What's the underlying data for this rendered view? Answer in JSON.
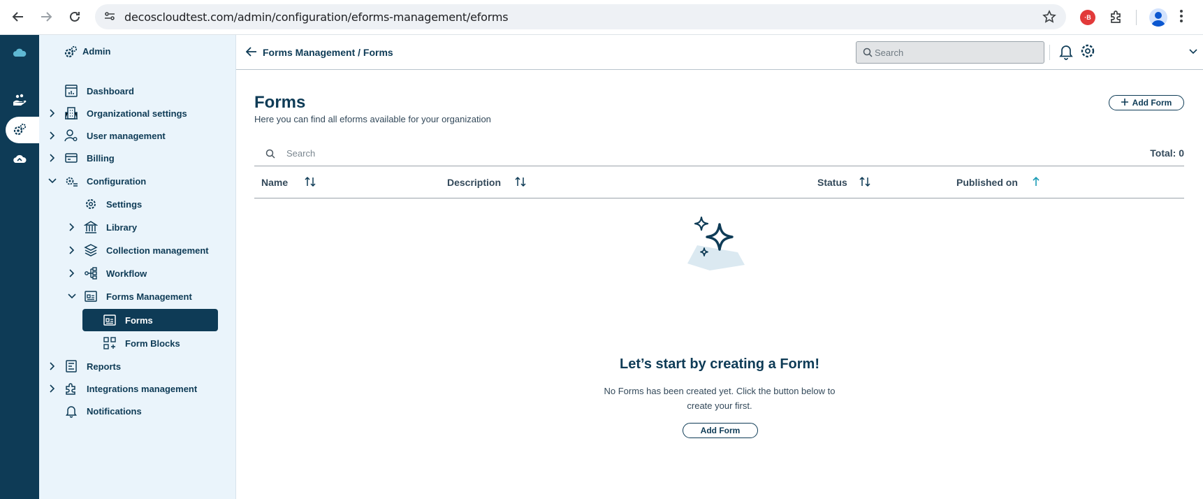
{
  "browser": {
    "url": "decoscloudtest.com/admin/configuration/eforms-management/eforms",
    "extension_badge": "·B"
  },
  "sidebar": {
    "title": "Admin",
    "items": [
      {
        "label": "Dashboard"
      },
      {
        "label": "Organizational settings"
      },
      {
        "label": "User management"
      },
      {
        "label": "Billing"
      },
      {
        "label": "Configuration"
      },
      {
        "label": "Settings"
      },
      {
        "label": "Library"
      },
      {
        "label": "Collection management"
      },
      {
        "label": "Workflow"
      },
      {
        "label": "Forms Management"
      },
      {
        "label": "Forms"
      },
      {
        "label": "Form Blocks"
      },
      {
        "label": "Reports"
      },
      {
        "label": "Integrations management"
      },
      {
        "label": "Notifications"
      }
    ]
  },
  "topbar": {
    "breadcrumb": "Forms Management / Forms",
    "search_placeholder": "Search"
  },
  "page": {
    "title": "Forms",
    "subtitle": "Here you can find all eforms available for your organization",
    "add_button": "Add Form",
    "table_search_placeholder": "Search",
    "total": "Total: 0",
    "columns": [
      "Name",
      "Description",
      "Status",
      "Published on"
    ]
  },
  "empty_state": {
    "title": "Let’s start by creating a Form!",
    "message": "No Forms has been created yet. Click the button below to create your first.",
    "button": "Add Form"
  },
  "colors": {
    "primary": "#0e3b56",
    "sidebar_bg": "#eaf4fb",
    "accent": "#1a9bb5"
  }
}
